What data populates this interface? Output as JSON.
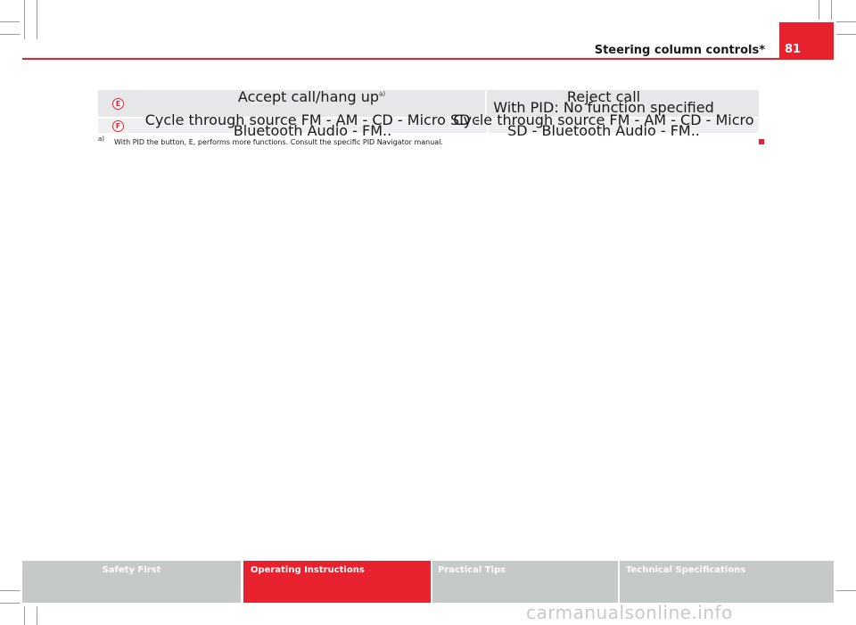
{
  "header": {
    "section_title": "Steering column controls*",
    "page_number": "81"
  },
  "table": {
    "rows": [
      {
        "key": "E",
        "col_a": "Accept call/hang up",
        "col_a_sup": "a)",
        "col_b_line1": "Reject call",
        "col_b_line2": "With PID: No function specified"
      },
      {
        "key": "F",
        "col_a": "Cycle through source FM - AM - CD - Micro SD - Bluetooth Audio - FM..",
        "col_b": "Cycle through source FM - AM - CD - Micro SD - Bluetooth Audio - FM.."
      }
    ]
  },
  "footnote": {
    "mark": "a)",
    "text": "With PID the button, E, performs more functions. Consult the specific PID Navigator manual."
  },
  "nav": {
    "tabs": [
      {
        "label": "Safety First",
        "active": false
      },
      {
        "label": "Operating Instructions",
        "active": true
      },
      {
        "label": "Practical Tips",
        "active": false
      },
      {
        "label": "Technical Specifications",
        "active": false
      }
    ]
  },
  "watermark": "carmanualsonline.info",
  "colors": {
    "accent": "#e8212f",
    "nav_inactive": "#c5c9c8",
    "row_bg": "#e6e7e8"
  }
}
